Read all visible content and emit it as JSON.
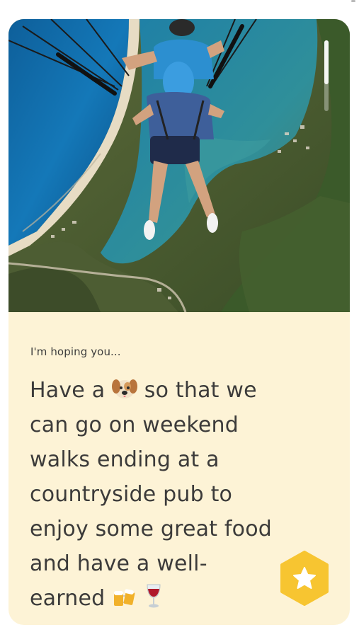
{
  "profile_card": {
    "photo": {
      "icon": "paragliding-photo"
    },
    "prompt": {
      "label": "I'm hoping you...",
      "answer_lines": [
        "Have a",
        "so that we",
        "can go on weekend",
        "walks ending at a",
        "countryside pub to",
        "enjoy some great food",
        "and have a well-",
        "earned"
      ],
      "emoji": [
        "dog-face-emoji",
        "beer-mugs-emoji",
        "wine-glass-emoji"
      ]
    },
    "like_button": {
      "icon": "star-icon",
      "color": "#f7c531"
    }
  },
  "colors": {
    "card_background": "#fdf3d6",
    "text": "#3c3b3a",
    "accent": "#f7c531"
  }
}
